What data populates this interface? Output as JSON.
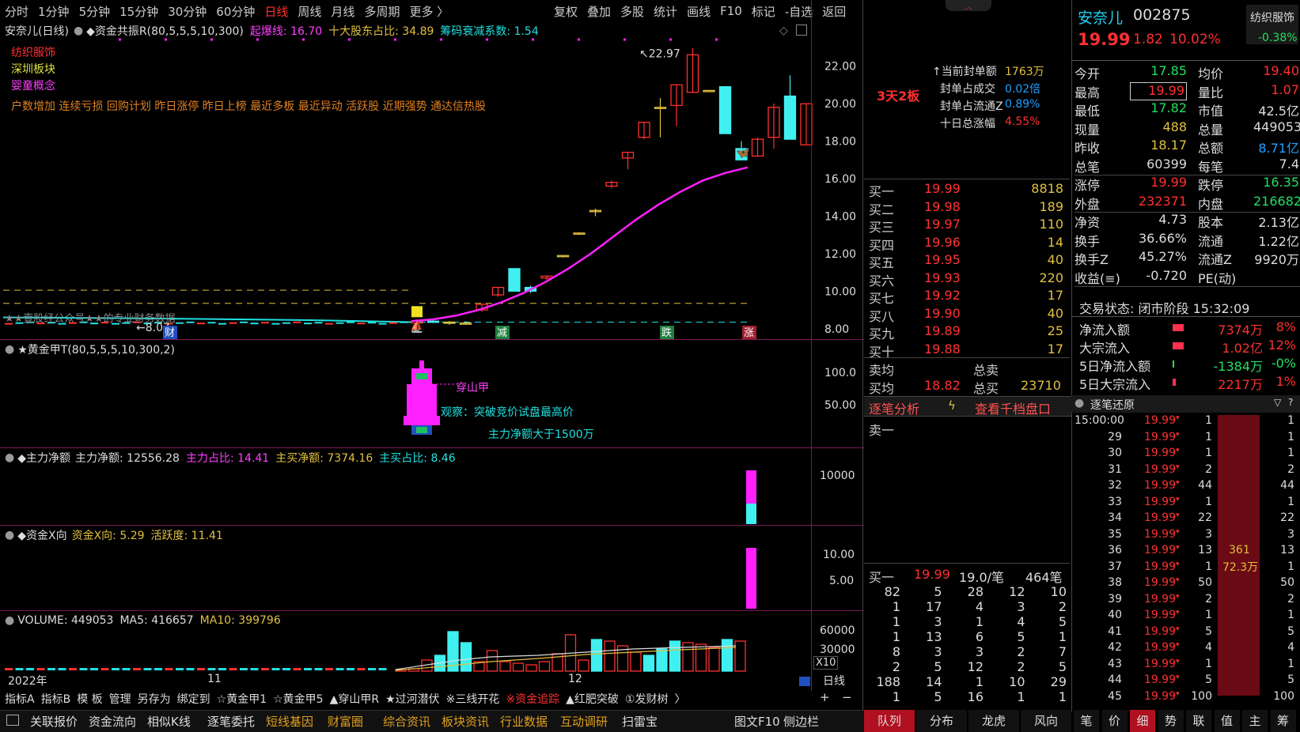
{
  "toolbar": {
    "items": [
      "分时",
      "1分钟",
      "5分钟",
      "15分钟",
      "30分钟",
      "60分钟",
      "日线",
      "周线",
      "月线",
      "多周期",
      "更多 〉"
    ],
    "active": "日线",
    "right": [
      "复权",
      "叠加",
      "多股",
      "统计",
      "画线",
      "F10",
      "标记",
      "-自选",
      "返回"
    ]
  },
  "chart_header": {
    "name": "安奈儿(日线)",
    "indicator": "◆资金共振R(80,5,5,5,10,300)",
    "qibao": "起爆线: 16.70",
    "top10": "十大股东占比: 34.89",
    "chouma": "筹码衰减系数: 1.54"
  },
  "tags": [
    "纺织服饰",
    "深圳板块",
    "婴童概念"
  ],
  "concepts": "户数增加 连续亏损 回购计划 昨日涨停 昨日上榜 最近多板 最近异动 活跃股 近期强势 通达信热股",
  "watermark": "★★壹股经公众号★★的专业财务数据",
  "main_axis": [
    "22.00",
    "20.00",
    "18.00",
    "16.00",
    "14.00",
    "12.00",
    "10.00",
    "8.00"
  ],
  "high_label": "22.97",
  "low_label": "8.07",
  "markers": {
    "cai": "财",
    "jian": "减",
    "die": "跌",
    "zhang": "涨"
  },
  "x_axis": {
    "y2022": "2022年",
    "m11": "11",
    "m12": "12",
    "period": "日线",
    "zoom": "X10"
  },
  "chart_data": {
    "type": "candlestick",
    "dates": [],
    "candles": [
      {
        "o": 8.3,
        "h": 8.5,
        "l": 8.2,
        "c": 8.4
      },
      {
        "o": 8.4,
        "h": 8.5,
        "l": 8.3,
        "c": 8.35
      },
      {
        "o": 8.35,
        "h": 8.4,
        "l": 8.2,
        "c": 8.3
      },
      {
        "o": 8.3,
        "h": 8.4,
        "l": 8.2,
        "c": 8.3
      },
      {
        "o": 9.0,
        "h": 9.3,
        "l": 8.9,
        "c": 9.3
      },
      {
        "o": 9.8,
        "h": 10.2,
        "l": 9.7,
        "c": 10.2
      },
      {
        "o": 11.2,
        "h": 11.2,
        "l": 10.0,
        "c": 10.0
      },
      {
        "o": 10.2,
        "h": 10.3,
        "l": 9.9,
        "c": 10.0
      },
      {
        "o": 10.7,
        "h": 10.8,
        "l": 10.6,
        "c": 10.8
      },
      {
        "o": 11.9,
        "h": 11.9,
        "l": 11.8,
        "c": 11.9
      },
      {
        "o": 13.1,
        "h": 13.1,
        "l": 13.0,
        "c": 13.1
      },
      {
        "o": 14.3,
        "h": 14.4,
        "l": 14.0,
        "c": 14.3
      },
      {
        "o": 15.6,
        "h": 15.9,
        "l": 15.5,
        "c": 15.8
      },
      {
        "o": 17.1,
        "h": 17.4,
        "l": 16.5,
        "c": 17.4
      },
      {
        "o": 18.2,
        "h": 19.0,
        "l": 18.1,
        "c": 19.0
      },
      {
        "o": 19.8,
        "h": 20.3,
        "l": 18.2,
        "c": 19.8
      },
      {
        "o": 19.9,
        "h": 21.0,
        "l": 18.8,
        "c": 21.0
      },
      {
        "o": 20.6,
        "h": 22.97,
        "l": 20.6,
        "c": 22.6
      },
      {
        "o": 20.7,
        "h": 20.7,
        "l": 20.7,
        "c": 20.7
      },
      {
        "o": 20.9,
        "h": 20.9,
        "l": 18.4,
        "c": 18.4
      },
      {
        "o": 17.6,
        "h": 18.0,
        "l": 17.0,
        "c": 17.0
      },
      {
        "o": 17.2,
        "h": 18.2,
        "l": 17.2,
        "c": 18.1
      },
      {
        "o": 18.2,
        "h": 20.0,
        "l": 17.6,
        "c": 19.8
      },
      {
        "o": 20.4,
        "h": 21.5,
        "l": 18.1,
        "c": 18.1
      },
      {
        "o": 17.8,
        "h": 19.99,
        "l": 17.82,
        "c": 19.99
      }
    ],
    "ma": {
      "name": "",
      "values": [
        8.4,
        8.5,
        8.7,
        9.0,
        9.4,
        9.9,
        10.5,
        11.2,
        12.0,
        12.9,
        13.8,
        14.6,
        15.3,
        15.9,
        16.3,
        16.6
      ]
    },
    "ylim": [
      7.4,
      23.5
    ]
  },
  "panel2": {
    "title": "★黄金甲T(80,5,5,5,10,300,2)",
    "label1": "穿山甲",
    "label2": "观察：突破竞价试盘最高价",
    "label3": "主力净额大于1500万",
    "axis": [
      "100.0",
      "50.00"
    ]
  },
  "panel3": {
    "title": "◆主力净额",
    "v1": "主力净额: 12556.28",
    "v2": "主力占比: 14.41",
    "v3": "主买净额: 7374.16",
    "v4": "主买占比: 8.46",
    "axis": [
      "10000"
    ]
  },
  "panel4": {
    "title": "◆资金X向",
    "v1": "资金X向: 5.29",
    "v2": "活跃度: 11.41",
    "axis": [
      "10.00",
      "5.00"
    ]
  },
  "panel5": {
    "title": "VOLUME: 449053",
    "ma5": "MA5: 416657",
    "ma10": "MA10: 399796",
    "axis": [
      "60000",
      "30000"
    ]
  },
  "ind_tabs": [
    "指标A",
    "指标B",
    "模 板",
    "管理",
    "另存为",
    "绑定到",
    "☆黄金甲1",
    "☆黄金甲5",
    "▲穿山甲R",
    "★过河潜伏",
    "※三线开花",
    "※资金追踪",
    "▲红肥突破",
    "①发财树",
    "〉"
  ],
  "bottom_tabs": [
    "关联报价",
    "资金流向",
    "相似K线",
    "逐笔委托",
    "短线基因",
    "财富圈",
    "综合资讯",
    "板块资讯",
    "行业数据",
    "互动调研",
    "扫雷宝",
    "图文F10",
    "侧边栏"
  ],
  "mid": {
    "board": "3天2板",
    "info": [
      [
        "↑当前封单额",
        "1763万"
      ],
      [
        "封单占成交",
        "0.02倍"
      ],
      [
        "封单占流通Z",
        "0.89%"
      ],
      [
        "十日总涨幅",
        "4.55%"
      ]
    ],
    "bids": [
      [
        "买一",
        "19.99",
        "8818"
      ],
      [
        "买二",
        "19.98",
        "189"
      ],
      [
        "买三",
        "19.97",
        "110"
      ],
      [
        "买四",
        "19.96",
        "14"
      ],
      [
        "买五",
        "19.95",
        "40"
      ],
      [
        "买六",
        "19.93",
        "220"
      ],
      [
        "买七",
        "19.92",
        "17"
      ],
      [
        "买八",
        "19.90",
        "40"
      ],
      [
        "买九",
        "19.89",
        "25"
      ],
      [
        "买十",
        "19.88",
        "17"
      ]
    ],
    "sell_avg": "卖均",
    "total_sell": "总卖",
    "buy_avg": "买均",
    "buy_avg_v": "18.82",
    "total_buy": "总买",
    "total_buy_v": "23710",
    "analysis": "逐笔分析",
    "view1000": "查看千档盘口",
    "sell1": "卖一",
    "buy1_label": "买一",
    "buy1_price": "19.99",
    "buy1_per": "19.0/笔",
    "buy1_count": "464笔",
    "queue": [
      [
        "82",
        "5",
        "28",
        "12",
        "10"
      ],
      [
        "1",
        "17",
        "4",
        "3",
        "2"
      ],
      [
        "1",
        "3",
        "1",
        "4",
        "5"
      ],
      [
        "1",
        "13",
        "6",
        "5",
        "1"
      ],
      [
        "8",
        "3",
        "3",
        "2",
        "7"
      ],
      [
        "2",
        "5",
        "12",
        "2",
        "5"
      ],
      [
        "188",
        "14",
        "1",
        "10",
        "29"
      ],
      [
        "1",
        "5",
        "16",
        "1",
        "1"
      ]
    ],
    "tabs": [
      "队列",
      "分布",
      "龙虎",
      "风向"
    ]
  },
  "right": {
    "name": "安奈儿",
    "code": "002875",
    "sector": "纺织服饰",
    "price": "19.99",
    "chg": "1.82",
    "pct": "10.02%",
    "sector_pct": "-0.38%",
    "quote": [
      [
        "今开",
        "17.85",
        "均价",
        "19.40"
      ],
      [
        "最高",
        "19.99",
        "量比",
        "1.07"
      ],
      [
        "最低",
        "17.82",
        "市值",
        "42.5亿"
      ],
      [
        "现量",
        "488",
        "总量",
        "449053"
      ],
      [
        "昨收",
        "18.17",
        "总额",
        "8.71亿"
      ],
      [
        "总笔",
        "60399",
        "每笔",
        "7.4"
      ],
      [
        "涨停",
        "19.99",
        "跌停",
        "16.35"
      ],
      [
        "外盘",
        "232371",
        "内盘",
        "216682"
      ],
      [
        "净资",
        "4.73",
        "股本",
        "2.13亿"
      ],
      [
        "换手",
        "36.66%",
        "流通",
        "1.22亿"
      ],
      [
        "换手Z",
        "45.27%",
        "流通Z",
        "9920万"
      ],
      [
        "收益(≡)",
        "-0.720",
        "PE(动)",
        ""
      ]
    ],
    "status": "交易状态: 闭市阶段 15:32:09",
    "flows": [
      [
        "净流入额",
        "7374万",
        "8%"
      ],
      [
        "大宗流入",
        "1.02亿",
        "12%"
      ],
      [
        "5日净流入额",
        "-1384万",
        "-0%"
      ],
      [
        "5日大宗流入",
        "2217万",
        "1%"
      ]
    ],
    "ticks_title": "逐笔还原",
    "ticks": [
      [
        "15:00:00",
        "19.99",
        "1",
        "1"
      ],
      [
        "29",
        "19.99",
        "1",
        "1"
      ],
      [
        "30",
        "19.99",
        "1",
        "1"
      ],
      [
        "31",
        "19.99",
        "2",
        "2"
      ],
      [
        "32",
        "19.99",
        "44",
        "44"
      ],
      [
        "33",
        "19.99",
        "1",
        "1"
      ],
      [
        "34",
        "19.99",
        "22",
        "22"
      ],
      [
        "35",
        "19.99",
        "3",
        "3"
      ],
      [
        "36",
        "19.99",
        "13",
        "13"
      ],
      [
        "37",
        "19.99",
        "1",
        "1"
      ],
      [
        "38",
        "19.99",
        "50",
        "50"
      ],
      [
        "39",
        "19.99",
        "2",
        "2"
      ],
      [
        "40",
        "19.99",
        "1",
        "1"
      ],
      [
        "41",
        "19.99",
        "5",
        "5"
      ],
      [
        "42",
        "19.99",
        "4",
        "4"
      ],
      [
        "43",
        "19.99",
        "1",
        "1"
      ],
      [
        "44",
        "19.99",
        "5",
        "5"
      ],
      [
        "45",
        "19.99",
        "100",
        "100"
      ]
    ],
    "bar_label1": "361",
    "bar_label2": "72.3万",
    "tabs": [
      "笔",
      "价",
      "细",
      "势",
      "联",
      "值",
      "主",
      "筹"
    ]
  }
}
